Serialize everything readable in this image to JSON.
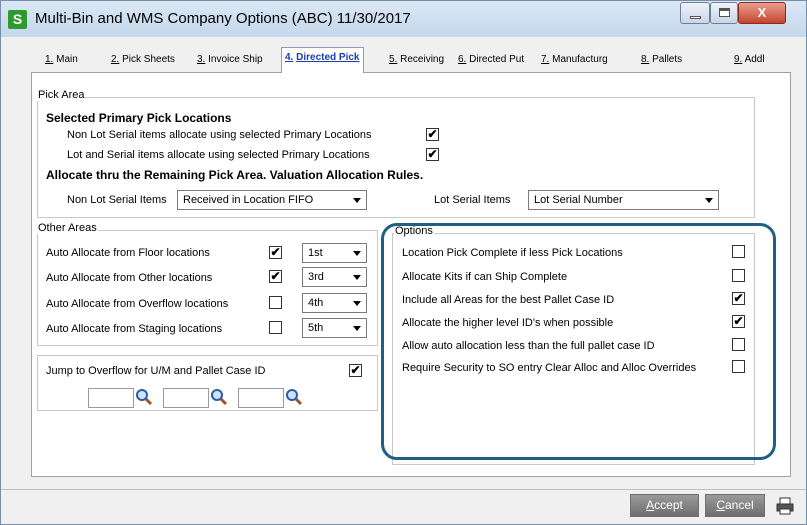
{
  "window": {
    "title": "Multi-Bin and WMS Company Options (ABC) 11/30/2017",
    "app_icon_letter": "S",
    "minimize_glyph": "",
    "maximize_glyph": "",
    "close_glyph": "X"
  },
  "tabs": [
    {
      "key": "1.",
      "label": "Main"
    },
    {
      "key": "2.",
      "label": "Pick Sheets"
    },
    {
      "key": "3.",
      "label": "Invoice Ship"
    },
    {
      "key": "4.",
      "label": "Directed Pick",
      "active": true
    },
    {
      "key": "5.",
      "label": "Receiving"
    },
    {
      "key": "6.",
      "label": "Directed Put"
    },
    {
      "key": "7.",
      "label": "Manufacturg"
    },
    {
      "key": "8.",
      "label": "Pallets"
    },
    {
      "key": "9.",
      "label": "Addl"
    }
  ],
  "pick_area": {
    "group_label": "Pick Area",
    "selected_heading": "Selected Primary Pick Locations",
    "non_lot_label": "Non Lot Serial items allocate using selected Primary Locations",
    "non_lot_checked": "✔",
    "lot_label": "Lot and Serial items allocate using selected Primary Locations",
    "lot_checked": "✔",
    "allocate_heading": "Allocate thru the Remaining Pick Area.  Valuation Allocation Rules.",
    "non_lot_items_label": "Non Lot Serial Items",
    "non_lot_items_value": "Received in Location FIFO",
    "lot_items_label": "Lot Serial Items",
    "lot_items_value": "Lot Serial Number"
  },
  "other_areas": {
    "group_label": "Other Areas",
    "rows": [
      {
        "label": "Auto Allocate from Floor locations",
        "checked": "✔",
        "value": "1st"
      },
      {
        "label": "Auto Allocate from Other locations",
        "checked": "✔",
        "value": "3rd"
      },
      {
        "label": "Auto Allocate from Overflow locations",
        "checked": "",
        "value": "4th"
      },
      {
        "label": "Auto Allocate from Staging locations",
        "checked": "",
        "value": "5th"
      }
    ]
  },
  "jump": {
    "label": "Jump to Overflow for U/M and Pallet Case ID",
    "checked": "✔"
  },
  "options": {
    "group_label": "Options",
    "rows": [
      {
        "label": "Location Pick Complete if less Pick Locations",
        "checked": ""
      },
      {
        "label": "Allocate Kits if can Ship Complete",
        "checked": ""
      },
      {
        "label": "Include all Areas for the best Pallet Case ID",
        "checked": "✔"
      },
      {
        "label": "Allocate the higher level ID's when possible",
        "checked": "✔"
      },
      {
        "label": "Allow auto allocation less than the full pallet case ID",
        "checked": ""
      },
      {
        "label": "Require Security to SO entry Clear Alloc and Alloc Overrides",
        "checked": ""
      }
    ]
  },
  "footer": {
    "accept_key": "A",
    "accept_rest": "ccept",
    "cancel_key": "C",
    "cancel_rest": "ancel"
  },
  "colors": {
    "highlight": "#1f5f80",
    "active_tab": "#1a3eb0"
  }
}
